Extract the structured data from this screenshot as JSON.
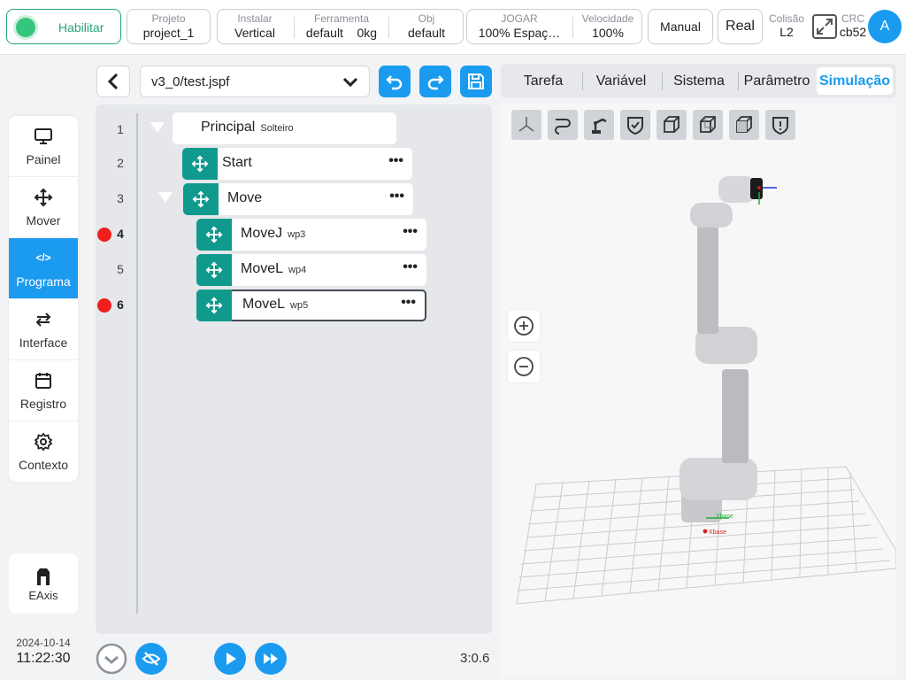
{
  "topbar": {
    "enable_label": "Habilitar",
    "project": {
      "key": "Projeto",
      "value": "project_1"
    },
    "install": {
      "key": "Instalar",
      "value": "Vertical"
    },
    "tool": {
      "key": "Ferramenta",
      "value": "default",
      "weight": "0kg"
    },
    "obj": {
      "key": "Obj",
      "value": "default"
    },
    "jog": {
      "key": "JOGAR",
      "value": "100%  Espaç…"
    },
    "speed": {
      "key": "Velocidade",
      "value": "100%"
    },
    "manual_label": "Manual",
    "real_label": "Real",
    "collision": {
      "key": "Colisão",
      "value": "L2"
    },
    "crc": {
      "key": "CRC",
      "value": "cb52"
    },
    "avatar_letter": "A",
    "enable_color": "#27a37a",
    "accent_color": "#1a9bef"
  },
  "nav": {
    "items": [
      {
        "label": "Painel",
        "icon": "monitor-icon"
      },
      {
        "label": "Mover",
        "icon": "move-arrows-icon"
      },
      {
        "label": "Programa",
        "icon": "code-icon",
        "glyph": "</>"
      },
      {
        "label": "Interface",
        "icon": "swap-arrows-icon"
      },
      {
        "label": "Registro",
        "icon": "calendar-icon"
      },
      {
        "label": "Contexto",
        "icon": "gear-icon"
      }
    ],
    "active": "Programa",
    "eaxis_label": "EAxis",
    "date": "2024-10-14",
    "time": "11:22:30"
  },
  "program": {
    "file": "v3_0/test.jspf",
    "line_numbers": [
      "1",
      "2",
      "3",
      "4",
      "5",
      "6"
    ],
    "breakpoints": [
      "4",
      "6"
    ],
    "nodes": [
      {
        "name": "Principal",
        "sub": "Solteiro"
      },
      {
        "name": "Start",
        "sub": ""
      },
      {
        "name": "Move",
        "sub": ""
      },
      {
        "name": "MoveJ",
        "sub": "wp3"
      },
      {
        "name": "MoveL",
        "sub": "wp4"
      },
      {
        "name": "MoveL",
        "sub": "wp5"
      }
    ],
    "menu_glyph": "•••",
    "selected_line": "6",
    "run_time": "3:0.6",
    "node_handle_color": "#109a8d"
  },
  "right": {
    "tabs": [
      "Tarefa",
      "Variável",
      "Sistema",
      "Parâmetro",
      "Simulação"
    ],
    "active_tab": "Simulação",
    "view_buttons": [
      "axes-view-icon",
      "path-icon",
      "robot-arm-icon",
      "shield-check-icon",
      "cube-view-1-icon",
      "cube-view-2-icon",
      "cube-view-3-icon",
      "shield-alert-icon"
    ],
    "axis_labels": {
      "x_base": "Xbase",
      "y_base": "Ybase"
    }
  }
}
